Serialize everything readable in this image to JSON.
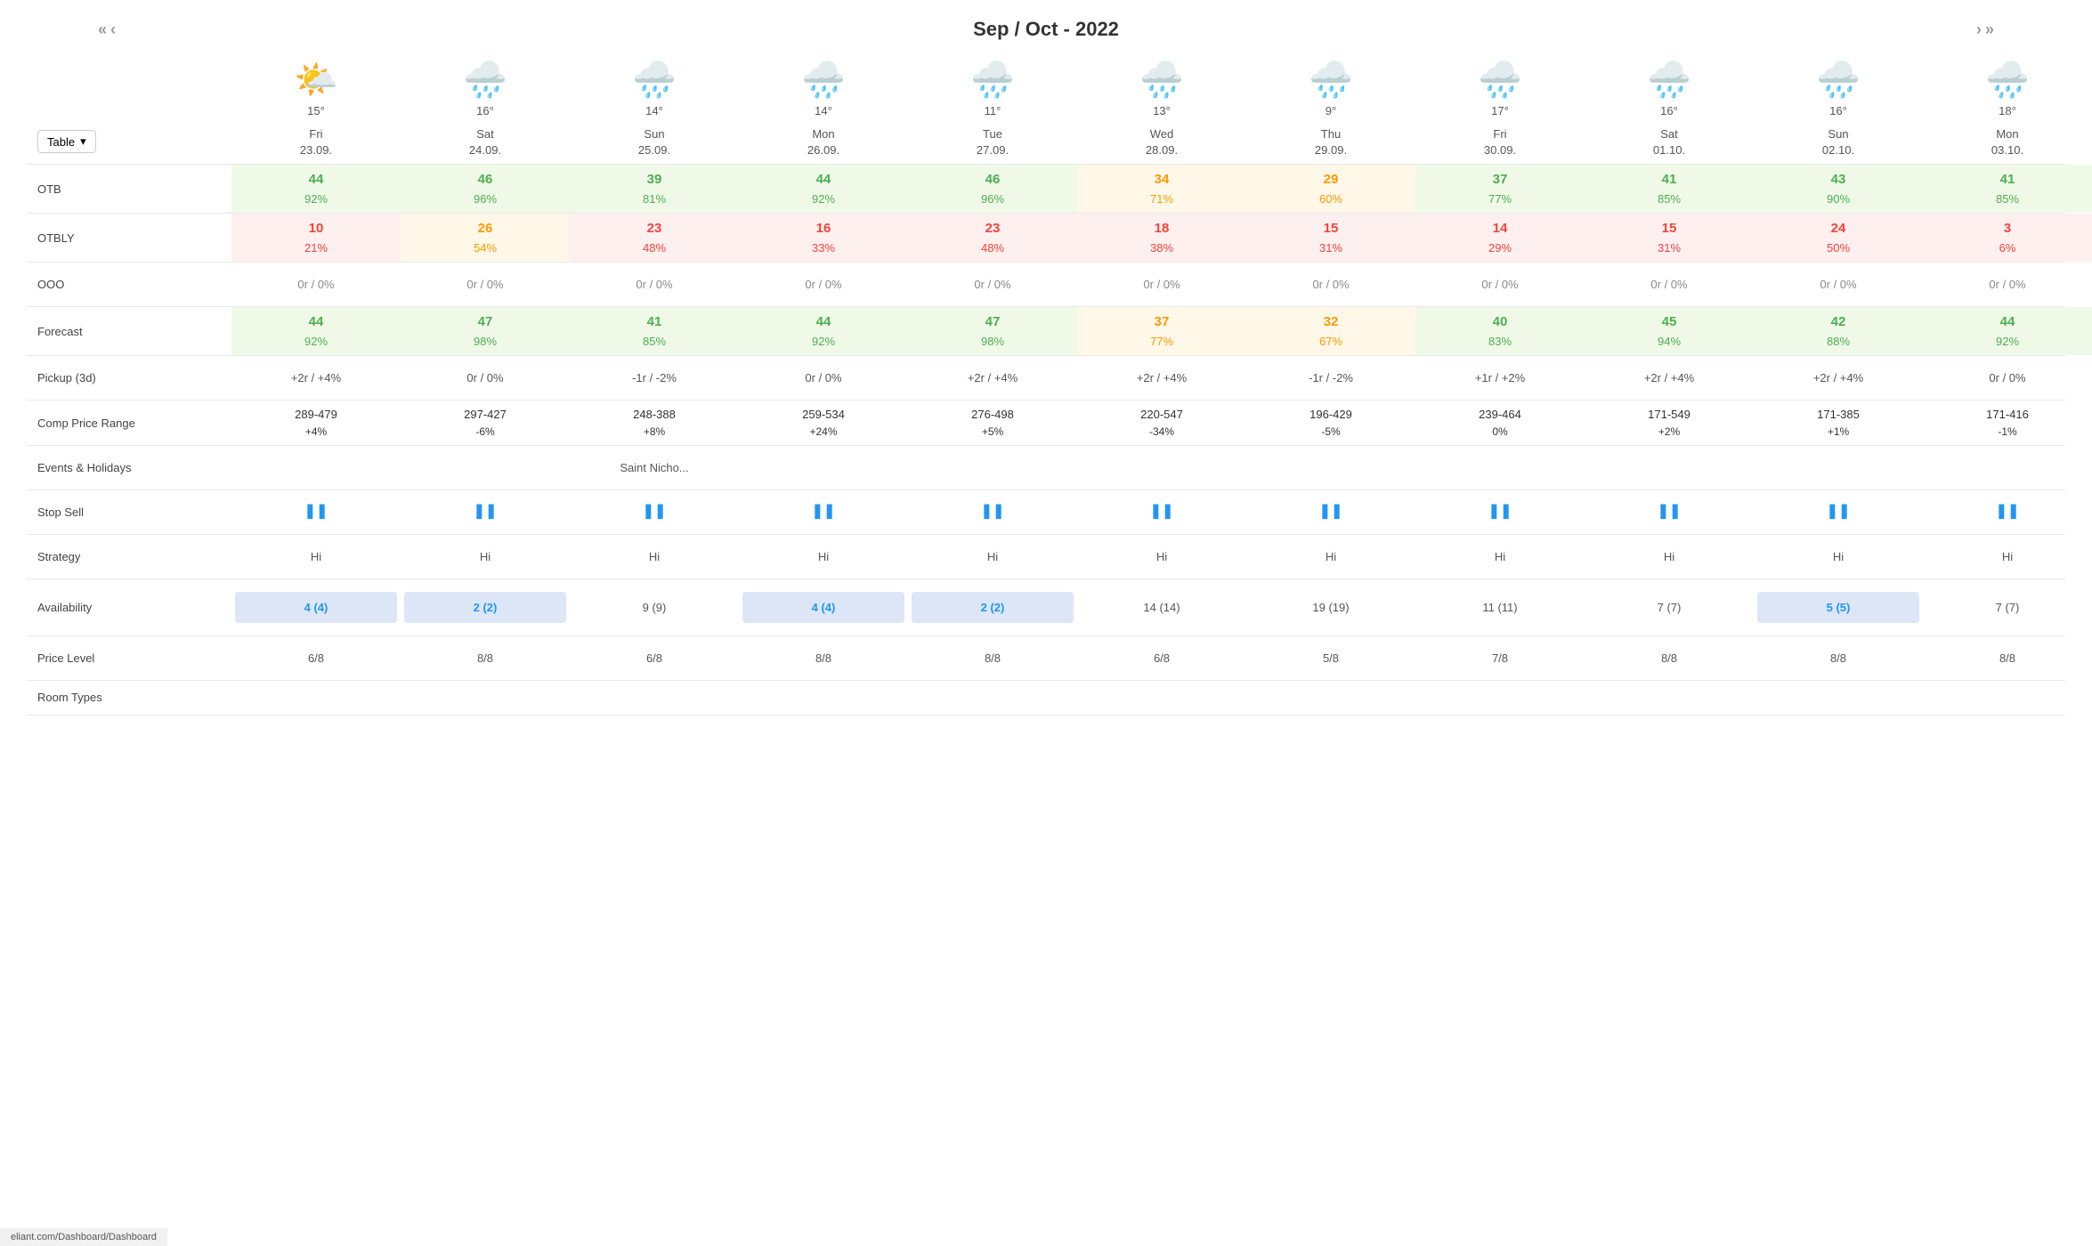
{
  "header": {
    "period": "Sep / Oct - 2022",
    "nav_left_double": "«",
    "nav_left_single": "‹",
    "nav_right_single": "›",
    "nav_right_double": "»"
  },
  "view_selector": {
    "label": "Table",
    "chevron": "▾"
  },
  "columns": [
    {
      "day": "Fri",
      "date": "23.09.",
      "temp": "15°",
      "weather": "partly-sunny"
    },
    {
      "day": "Sat",
      "date": "24.09.",
      "temp": "16°",
      "weather": "rainy"
    },
    {
      "day": "Sun",
      "date": "25.09.",
      "temp": "14°",
      "weather": "rainy"
    },
    {
      "day": "Mon",
      "date": "26.09.",
      "temp": "14°",
      "weather": "rainy"
    },
    {
      "day": "Tue",
      "date": "27.09.",
      "temp": "11°",
      "weather": "rainy"
    },
    {
      "day": "Wed",
      "date": "28.09.",
      "temp": "13°",
      "weather": "rainy"
    },
    {
      "day": "Thu",
      "date": "29.09.",
      "temp": "9°",
      "weather": "rainy"
    },
    {
      "day": "Fri",
      "date": "30.09.",
      "temp": "17°",
      "weather": "rainy"
    },
    {
      "day": "Sat",
      "date": "01.10.",
      "temp": "16°",
      "weather": "rainy"
    },
    {
      "day": "Sun",
      "date": "02.10.",
      "temp": "16°",
      "weather": "rainy"
    },
    {
      "day": "Mon",
      "date": "03.10.",
      "temp": "18°",
      "weather": "rainy"
    }
  ],
  "rows": {
    "otb": {
      "label": "OTB",
      "cells": [
        {
          "top": "44",
          "bottom": "92%",
          "color": "green"
        },
        {
          "top": "46",
          "bottom": "96%",
          "color": "green"
        },
        {
          "top": "39",
          "bottom": "81%",
          "color": "green"
        },
        {
          "top": "44",
          "bottom": "92%",
          "color": "green"
        },
        {
          "top": "46",
          "bottom": "96%",
          "color": "green"
        },
        {
          "top": "34",
          "bottom": "71%",
          "color": "orange"
        },
        {
          "top": "29",
          "bottom": "60%",
          "color": "orange"
        },
        {
          "top": "37",
          "bottom": "77%",
          "color": "green"
        },
        {
          "top": "41",
          "bottom": "85%",
          "color": "green"
        },
        {
          "top": "43",
          "bottom": "90%",
          "color": "green"
        },
        {
          "top": "41",
          "bottom": "85%",
          "color": "green"
        }
      ]
    },
    "otbly": {
      "label": "OTBLY",
      "cells": [
        {
          "top": "10",
          "bottom": "21%",
          "color": "red"
        },
        {
          "top": "26",
          "bottom": "54%",
          "color": "orange"
        },
        {
          "top": "23",
          "bottom": "48%",
          "color": "red"
        },
        {
          "top": "16",
          "bottom": "33%",
          "color": "red"
        },
        {
          "top": "23",
          "bottom": "48%",
          "color": "red"
        },
        {
          "top": "18",
          "bottom": "38%",
          "color": "red"
        },
        {
          "top": "15",
          "bottom": "31%",
          "color": "red"
        },
        {
          "top": "14",
          "bottom": "29%",
          "color": "red"
        },
        {
          "top": "15",
          "bottom": "31%",
          "color": "red"
        },
        {
          "top": "24",
          "bottom": "50%",
          "color": "red"
        },
        {
          "top": "3",
          "bottom": "6%",
          "color": "red"
        }
      ]
    },
    "ooo": {
      "label": "OOO",
      "cells": [
        "0r / 0%",
        "0r / 0%",
        "0r / 0%",
        "0r / 0%",
        "0r / 0%",
        "0r / 0%",
        "0r / 0%",
        "0r / 0%",
        "0r / 0%",
        "0r / 0%",
        "0r / 0%"
      ]
    },
    "forecast": {
      "label": "Forecast",
      "cells": [
        {
          "top": "44",
          "bottom": "92%",
          "color": "green"
        },
        {
          "top": "47",
          "bottom": "98%",
          "color": "green"
        },
        {
          "top": "41",
          "bottom": "85%",
          "color": "green"
        },
        {
          "top": "44",
          "bottom": "92%",
          "color": "green"
        },
        {
          "top": "47",
          "bottom": "98%",
          "color": "green"
        },
        {
          "top": "37",
          "bottom": "77%",
          "color": "orange"
        },
        {
          "top": "32",
          "bottom": "67%",
          "color": "orange"
        },
        {
          "top": "40",
          "bottom": "83%",
          "color": "green"
        },
        {
          "top": "45",
          "bottom": "94%",
          "color": "green"
        },
        {
          "top": "42",
          "bottom": "88%",
          "color": "green"
        },
        {
          "top": "44",
          "bottom": "92%",
          "color": "green"
        }
      ]
    },
    "pickup": {
      "label": "Pickup (3d)",
      "cells": [
        "+2r / +4%",
        "0r / 0%",
        "-1r / -2%",
        "0r / 0%",
        "+2r / +4%",
        "+2r / +4%",
        "-1r / -2%",
        "+1r / +2%",
        "+2r / +4%",
        "+2r / +4%",
        "0r / 0%"
      ]
    },
    "comp_price": {
      "label": "Comp Price Range",
      "cells": [
        {
          "top": "289-479",
          "bottom": "+4%"
        },
        {
          "top": "297-427",
          "bottom": "-6%"
        },
        {
          "top": "248-388",
          "bottom": "+8%"
        },
        {
          "top": "259-534",
          "bottom": "+24%"
        },
        {
          "top": "276-498",
          "bottom": "+5%"
        },
        {
          "top": "220-547",
          "bottom": "-34%"
        },
        {
          "top": "196-429",
          "bottom": "-5%"
        },
        {
          "top": "239-464",
          "bottom": "0%"
        },
        {
          "top": "171-549",
          "bottom": "+2%"
        },
        {
          "top": "171-385",
          "bottom": "+1%"
        },
        {
          "top": "171-416",
          "bottom": "-1%"
        }
      ]
    },
    "events": {
      "label": "Events & Holidays",
      "cells": [
        "",
        "",
        "Saint Nicho...",
        "",
        "",
        "",
        "",
        "",
        "",
        "",
        ""
      ]
    },
    "stop_sell": {
      "label": "Stop Sell",
      "icon": "❚❚",
      "cells": 11
    },
    "strategy": {
      "label": "Strategy",
      "cells": [
        "Hi",
        "Hi",
        "Hi",
        "Hi",
        "Hi",
        "Hi",
        "Hi",
        "Hi",
        "Hi",
        "Hi",
        "Hi"
      ]
    },
    "availability": {
      "label": "Availability",
      "cells": [
        {
          "value": "4 (4)",
          "highlight": true,
          "blue": true
        },
        {
          "value": "2 (2)",
          "highlight": true,
          "blue": true
        },
        {
          "value": "9 (9)",
          "highlight": false,
          "blue": false
        },
        {
          "value": "4 (4)",
          "highlight": true,
          "blue": true
        },
        {
          "value": "2 (2)",
          "highlight": true,
          "blue": true
        },
        {
          "value": "14 (14)",
          "highlight": false,
          "blue": false
        },
        {
          "value": "19 (19)",
          "highlight": false,
          "blue": false
        },
        {
          "value": "11 (11)",
          "highlight": false,
          "blue": false
        },
        {
          "value": "7 (7)",
          "highlight": false,
          "blue": false
        },
        {
          "value": "5 (5)",
          "highlight": true,
          "blue": true
        },
        {
          "value": "7 (7)",
          "highlight": false,
          "blue": false
        }
      ]
    },
    "price_level": {
      "label": "Price Level",
      "cells": [
        "6/8",
        "8/8",
        "6/8",
        "8/8",
        "8/8",
        "6/8",
        "5/8",
        "7/8",
        "8/8",
        "8/8",
        "8/8"
      ]
    },
    "room_types": {
      "label": "Room Types"
    }
  },
  "bottom_bar": {
    "url": "eliant.com/Dashboard/Dashboard"
  }
}
